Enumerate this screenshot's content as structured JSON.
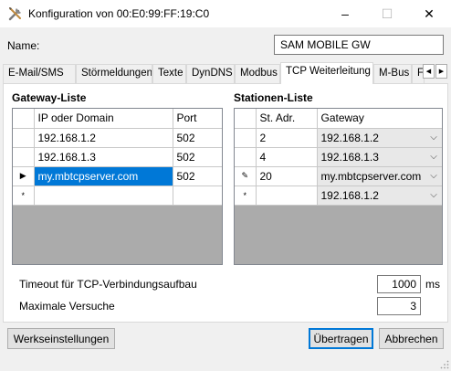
{
  "window": {
    "title": "Konfiguration von 00:E0:99:FF:19:C0",
    "icon": "wrench-screwdriver-icon",
    "controls": {
      "minimize": "–",
      "maximize": "☐",
      "close": "✕"
    }
  },
  "name_field": {
    "label": "Name:",
    "value": "SAM MOBILE GW"
  },
  "tabs": [
    {
      "label": "E-Mail/SMS",
      "active": false
    },
    {
      "label": "Störmeldungen",
      "active": false
    },
    {
      "label": "Texte",
      "active": false
    },
    {
      "label": "DynDNS",
      "active": false
    },
    {
      "label": "Modbus",
      "active": false
    },
    {
      "label": "TCP Weiterleitung",
      "active": true
    },
    {
      "label": "M-Bus",
      "active": false
    },
    {
      "label": "F",
      "active": false
    }
  ],
  "tab_scroll": {
    "left": "◀",
    "right": "▶"
  },
  "gateway_list": {
    "title": "Gateway-Liste",
    "headers": {
      "address": "IP oder Domain",
      "port": "Port"
    },
    "rows": [
      {
        "marker": "",
        "address": "192.168.1.2",
        "port": "502"
      },
      {
        "marker": "",
        "address": "192.168.1.3",
        "port": "502"
      },
      {
        "marker": "▶",
        "address": "my.mbtcpserver.com",
        "port": "502"
      },
      {
        "marker": "*",
        "address": "",
        "port": ""
      }
    ],
    "selected_row": 2
  },
  "station_list": {
    "title": "Stationen-Liste",
    "headers": {
      "station": "St. Adr.",
      "gateway": "Gateway"
    },
    "rows": [
      {
        "marker": "",
        "station": "2",
        "gateway": "192.168.1.2"
      },
      {
        "marker": "",
        "station": "4",
        "gateway": "192.168.1.3"
      },
      {
        "marker": "✎",
        "station": "20",
        "gateway": "my.mbtcpserver.com"
      },
      {
        "marker": "*",
        "station": "",
        "gateway": "192.168.1.2"
      }
    ],
    "combo_arrow": "⌵"
  },
  "timeout": {
    "label": "Timeout für TCP-Verbindungsaufbau",
    "value": "1000",
    "unit": "ms"
  },
  "retries": {
    "label": "Maximale Versuche",
    "value": "3"
  },
  "buttons": {
    "factory_reset": "Werkseinstellungen",
    "transfer": "Übertragen",
    "cancel": "Abbrechen"
  },
  "colors": {
    "selection": "#0078d7",
    "window_bg": "#f0f0f0",
    "grid_empty": "#ababab"
  }
}
